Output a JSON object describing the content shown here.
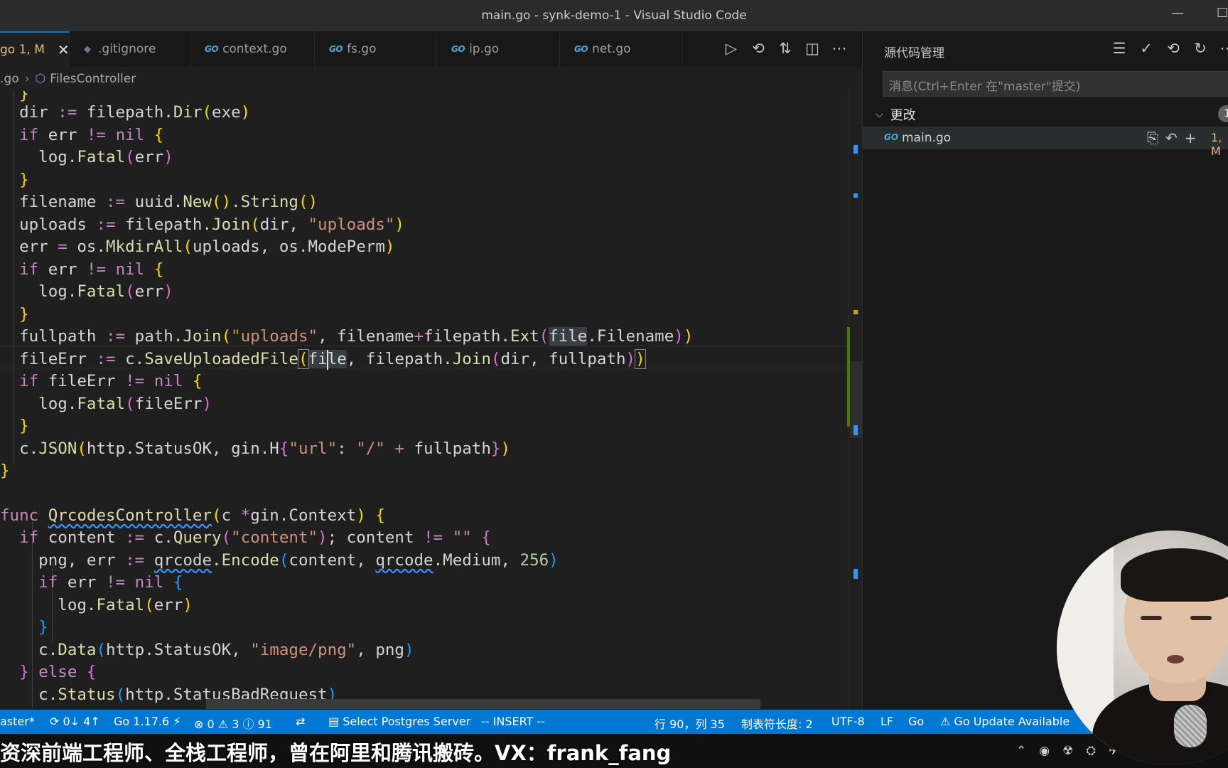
{
  "window": {
    "title": "main.go - synk-demo-1 - Visual Studio Code",
    "minimize": "—",
    "maximize": "☐"
  },
  "tabs": [
    {
      "label": "go 1, M",
      "active": true,
      "close": "✕"
    },
    {
      "label": ".gitignore",
      "icon": "git-file-icon"
    },
    {
      "label": "context.go",
      "icon": "go-file-icon"
    },
    {
      "label": "fs.go",
      "icon": "go-file-icon"
    },
    {
      "label": "ip.go",
      "icon": "go-file-icon"
    },
    {
      "label": "net.go",
      "icon": "go-file-icon"
    }
  ],
  "go_icon_text": "GO",
  "editor_actions": [
    "▷",
    "⟲",
    "⇅",
    "◫",
    "⋯"
  ],
  "breadcrumb": {
    "file": ".go",
    "separator": "›",
    "symbol_icon": "⬡",
    "symbol": "FilesController"
  },
  "source_control": {
    "title": "源代码管理",
    "actions": [
      "☰",
      "✓",
      "⟲",
      "↻",
      "⋯"
    ],
    "commit_placeholder": "消息(Ctrl+Enter 在\"master\"提交)",
    "changes_label": "更改",
    "changes_chevron": "⌵",
    "changes_count": "1",
    "file": {
      "name": "main.go",
      "actions": [
        "⎘",
        "↶",
        "+"
      ],
      "status": "1, M"
    }
  },
  "status_bar": {
    "branch": "aster*",
    "sync": "⟳ 0↓ 4↑",
    "go_version": "Go 1.17.6 ⚡",
    "problems": "⊗ 0 ⚠ 3 ⓘ 91",
    "live_share": "⇄",
    "postgres": "▤ Select Postgres Server",
    "mode": "-- INSERT --",
    "position": "行 90，列 35",
    "tab_size": "制表符长度: 2",
    "encoding": "UTF-8",
    "eol": "LF",
    "language": "Go",
    "update": "⚠ Go Update Available"
  },
  "subtitle": "资深前端工程师、全栈工程师，曾在阿里和腾讯搬砖。VX：frank_fang",
  "tray_icons": [
    "⌃",
    "◉",
    "☢",
    "⛭",
    "✈"
  ],
  "colors": {
    "accent": "#0078d4",
    "modified": "#e2c08d",
    "go": "#4fa6d8"
  }
}
